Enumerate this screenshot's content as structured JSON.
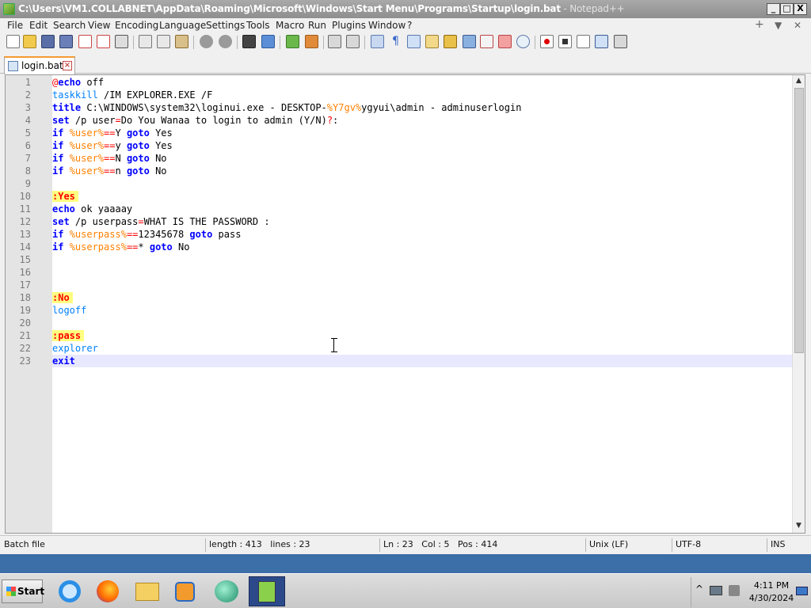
{
  "window": {
    "title_path": "C:\\Users\\VM1.COLLABNET\\AppData\\Roaming\\Microsoft\\Windows\\Start Menu\\Programs\\Startup\\login.bat",
    "title_app": " - Notepad++",
    "minimize": "_",
    "maximize": "□",
    "close": "X"
  },
  "menu": {
    "items": [
      "File",
      "Edit",
      "Search",
      "View",
      "Encoding",
      "Language",
      "Settings",
      "Tools",
      "Macro",
      "Run",
      "Plugins",
      "Window",
      "?"
    ],
    "right_controls": [
      "+",
      "▼",
      "✕"
    ]
  },
  "tab": {
    "label": "login.bat",
    "close": "×"
  },
  "editor": {
    "line_numbers": [
      "1",
      "2",
      "3",
      "4",
      "5",
      "6",
      "7",
      "8",
      "9",
      "10",
      "11",
      "12",
      "13",
      "14",
      "15",
      "16",
      "17",
      "18",
      "19",
      "20",
      "21",
      "22",
      "23"
    ],
    "lines": [
      "@echo off",
      "taskkill /IM EXPLORER.EXE /F",
      "title C:\\WINDOWS\\system32\\loginui.exe - DESKTOP-%Y7gv%ygyui\\admin - adminuserlogin",
      "set /p user=Do You Wanaa to login to admin (Y/N)?:",
      "if %user%==Y goto Yes",
      "if %user%==y goto Yes",
      "if %user%==N goto No",
      "if %user%==n goto No",
      "",
      ":Yes",
      "echo ok yaaaay",
      "set /p userpass=WHAT IS THE PASSWORD :",
      "if %userpass%==12345678 goto pass",
      "if %userpass%==* goto No",
      "",
      "",
      "",
      ":No",
      "logoff",
      "",
      ":pass",
      "explorer",
      "exit"
    ],
    "current_line": 23
  },
  "status": {
    "file_type": "Batch file",
    "length": "length : 413",
    "lines": "lines : 23",
    "ln": "Ln : 23",
    "col": "Col : 5",
    "pos": "Pos : 414",
    "eol": "Unix (LF)",
    "encoding": "UTF-8",
    "mode": "INS"
  },
  "taskbar": {
    "start_label": "Start",
    "apps": [
      "internet-explorer",
      "firefox",
      "file-explorer",
      "media-player",
      "chat-app",
      "notepad-plus-plus"
    ],
    "clock_time": "4:11 PM",
    "clock_date": "4/30/2024"
  },
  "colors": {
    "keyword": "#0000ff",
    "variable": "#ff8000",
    "label_bg": "#ffff80",
    "current_line": "#e8e8ff",
    "tab_accent": "#f59a30"
  }
}
